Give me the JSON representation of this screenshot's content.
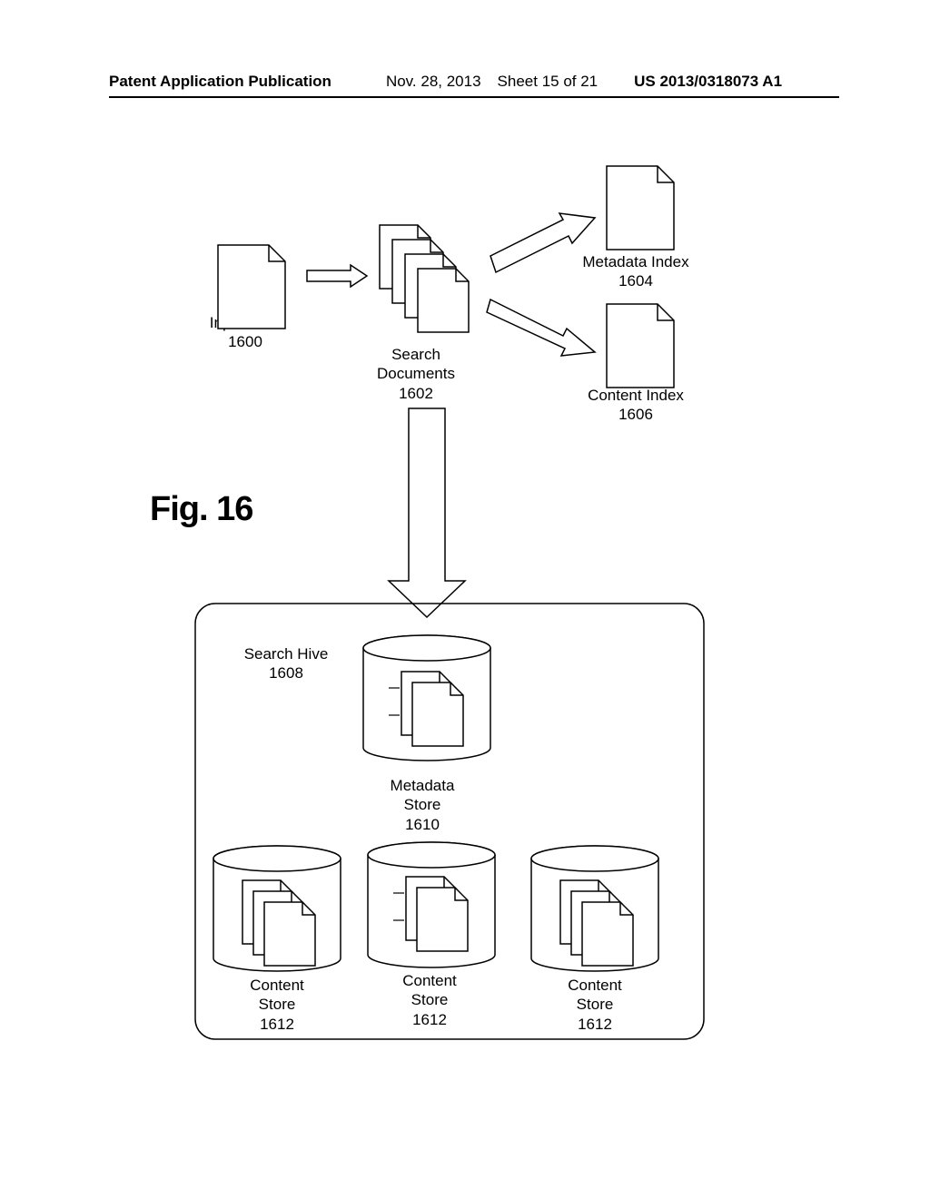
{
  "freeform_image_html_recreation": {
    "note": "Patent diagram page — single-page static recreation"
  },
  "header": {
    "pub": "Patent Application Publication",
    "date": "Nov. 28, 2013",
    "sheet": "Sheet 15 of 21",
    "pubno": "US 2013/0318073 A1"
  },
  "figure_label": "Fig. 16",
  "labels": {
    "input_data": "Input Data\n1600",
    "search_documents": "Search\nDocuments\n1602",
    "metadata_index": "Metadata Index\n1604",
    "content_index": "Content Index\n1606",
    "search_hive": "Search Hive\n1608",
    "metadata_store": "Metadata\nStore\n1610",
    "content_store_1": "Content\nStore\n1612",
    "content_store_2": "Content\nStore\n1612",
    "content_store_3": "Content\nStore\n1612"
  }
}
